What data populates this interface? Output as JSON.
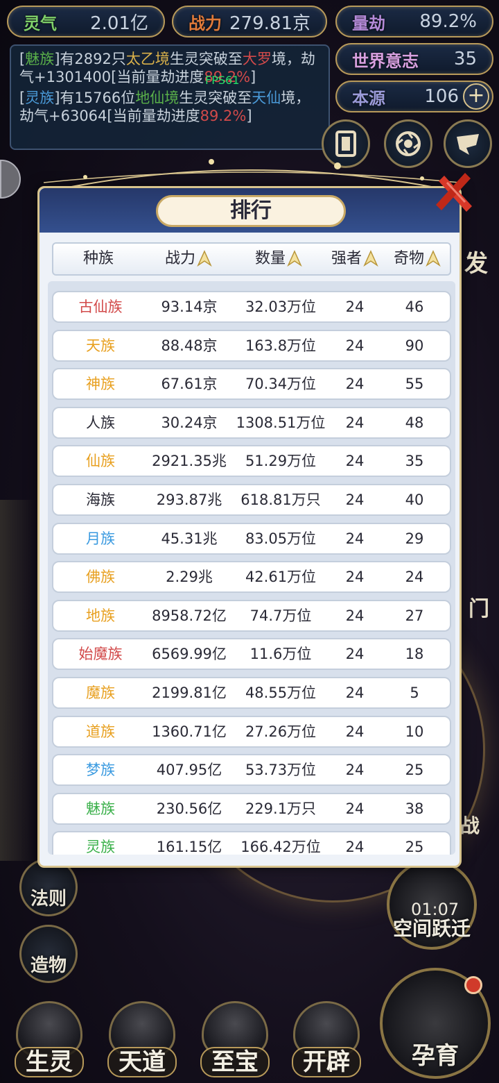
{
  "stats": {
    "lingqi": {
      "label": "灵气",
      "value": "2.01亿"
    },
    "zhanli": {
      "label": "战力",
      "value": "279.81京"
    },
    "liangjie": {
      "label": "量劫",
      "value": "89.2%"
    },
    "yizhi": {
      "label": "世界意志",
      "value": "35"
    },
    "benyuan": {
      "label": "本源",
      "value": "106"
    }
  },
  "fps": "FPS61",
  "log": {
    "line1": {
      "bracket_open": "[",
      "race": "魅族",
      "bracket_close": "]",
      "t1": "有2892只",
      "realm": "太乙境",
      "t2": "生灵突破至",
      "target": "大罗",
      "t3": "境，劫气+1301400[当前量劫进度",
      "pct": "89.2%",
      "t4": "]"
    },
    "line2": {
      "bracket_open": "[",
      "race": "灵族",
      "bracket_close": "]",
      "t1": "有15766位",
      "realm": "地仙境",
      "t2": "生灵突破至",
      "target": "天仙",
      "t3": "境，劫气+63064[当前量劫进度",
      "pct": "89.2%",
      "t4": "]"
    }
  },
  "side": {
    "right_partial_1": "发",
    "right_partial_2": "门",
    "right_partial_3": "战",
    "left_btns": [
      "法则",
      "造物"
    ],
    "timer": "01:07",
    "jump_label": "空间跃迁",
    "yunyu": "孕育"
  },
  "tabs": [
    "生灵",
    "天道",
    "至宝",
    "开辟"
  ],
  "modal": {
    "title": "排行",
    "columns": [
      "种族",
      "战力",
      "数量",
      "强者",
      "奇物"
    ],
    "rows": [
      {
        "race": "古仙族",
        "color": "#d24a4a",
        "power": "93.14京",
        "count": "32.03万位",
        "strong": "24",
        "items": "46"
      },
      {
        "race": "天族",
        "color": "#e8a020",
        "power": "88.48京",
        "count": "163.8万位",
        "strong": "24",
        "items": "90"
      },
      {
        "race": "神族",
        "color": "#e8a020",
        "power": "67.61京",
        "count": "70.34万位",
        "strong": "24",
        "items": "55"
      },
      {
        "race": "人族",
        "color": "#2a2a36",
        "power": "30.24京",
        "count": "1308.51万位",
        "strong": "24",
        "items": "48"
      },
      {
        "race": "仙族",
        "color": "#e8a020",
        "power": "2921.35兆",
        "count": "51.29万位",
        "strong": "24",
        "items": "35"
      },
      {
        "race": "海族",
        "color": "#2a2a36",
        "power": "293.87兆",
        "count": "618.81万只",
        "strong": "24",
        "items": "40"
      },
      {
        "race": "月族",
        "color": "#3a9ae0",
        "power": "45.31兆",
        "count": "83.05万位",
        "strong": "24",
        "items": "29"
      },
      {
        "race": "佛族",
        "color": "#e8a020",
        "power": "2.29兆",
        "count": "42.61万位",
        "strong": "24",
        "items": "24"
      },
      {
        "race": "地族",
        "color": "#e8a020",
        "power": "8958.72亿",
        "count": "74.7万位",
        "strong": "24",
        "items": "27"
      },
      {
        "race": "始魔族",
        "color": "#d24a4a",
        "power": "6569.99亿",
        "count": "11.6万位",
        "strong": "24",
        "items": "18"
      },
      {
        "race": "魔族",
        "color": "#e8a020",
        "power": "2199.81亿",
        "count": "48.55万位",
        "strong": "24",
        "items": "5"
      },
      {
        "race": "道族",
        "color": "#e8a020",
        "power": "1360.71亿",
        "count": "27.26万位",
        "strong": "24",
        "items": "10"
      },
      {
        "race": "梦族",
        "color": "#3a9ae0",
        "power": "407.95亿",
        "count": "53.73万位",
        "strong": "24",
        "items": "25"
      },
      {
        "race": "魅族",
        "color": "#3ab04a",
        "power": "230.56亿",
        "count": "229.1万只",
        "strong": "24",
        "items": "38"
      },
      {
        "race": "灵族",
        "color": "#3ab04a",
        "power": "161.15亿",
        "count": "166.42万位",
        "strong": "24",
        "items": "25"
      }
    ]
  }
}
